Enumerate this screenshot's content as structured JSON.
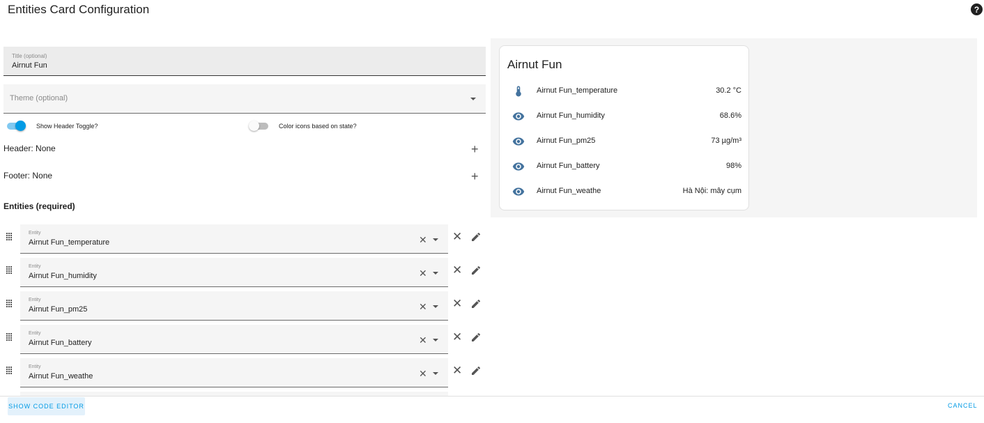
{
  "dialog": {
    "title": "Entities Card Configuration",
    "help_icon": "help-circle-icon",
    "help_glyph": "?"
  },
  "editor": {
    "title_field": {
      "label": "Title (optional)",
      "value": "Airnut Fun"
    },
    "theme_field": {
      "placeholder": "Theme (optional)",
      "value": ""
    },
    "toggles": [
      {
        "label": "Show Header Toggle?",
        "on": true
      },
      {
        "label": "Color icons based on state?",
        "on": false
      }
    ],
    "header": {
      "label": "Header: None",
      "add_icon": "plus-icon",
      "add_glyph": "+"
    },
    "footer": {
      "label": "Footer: None",
      "add_icon": "plus-icon",
      "add_glyph": "+"
    },
    "entities_heading": "Entities (required)",
    "entities": [
      {
        "label": "Entity",
        "value": "Airnut Fun_temperature"
      },
      {
        "label": "Entity",
        "value": "Airnut Fun_humidity"
      },
      {
        "label": "Entity",
        "value": "Airnut Fun_pm25"
      },
      {
        "label": "Entity",
        "value": "Airnut Fun_battery"
      },
      {
        "label": "Entity",
        "value": "Airnut Fun_weathe"
      }
    ],
    "row_controls": {
      "clear_glyph": "✕",
      "remove_glyph": "✕"
    }
  },
  "preview": {
    "card_title": "Airnut Fun",
    "rows": [
      {
        "icon": "thermometer-icon",
        "name": "Airnut Fun_temperature",
        "state": "30.2 °C"
      },
      {
        "icon": "eye-icon",
        "name": "Airnut Fun_humidity",
        "state": "68.6%"
      },
      {
        "icon": "eye-icon",
        "name": "Airnut Fun_pm25",
        "state": "73 µg/m³"
      },
      {
        "icon": "eye-icon",
        "name": "Airnut Fun_battery",
        "state": "98%"
      },
      {
        "icon": "eye-icon",
        "name": "Airnut Fun_weathe",
        "state": "Hà Nội: mây cụm"
      }
    ]
  },
  "footer_actions": {
    "code_editor": "SHOW CODE EDITOR",
    "cancel": "CANCEL"
  },
  "colors": {
    "accent": "#039be5",
    "icon": "#44739e",
    "field_bg": "#f5f5f5"
  }
}
